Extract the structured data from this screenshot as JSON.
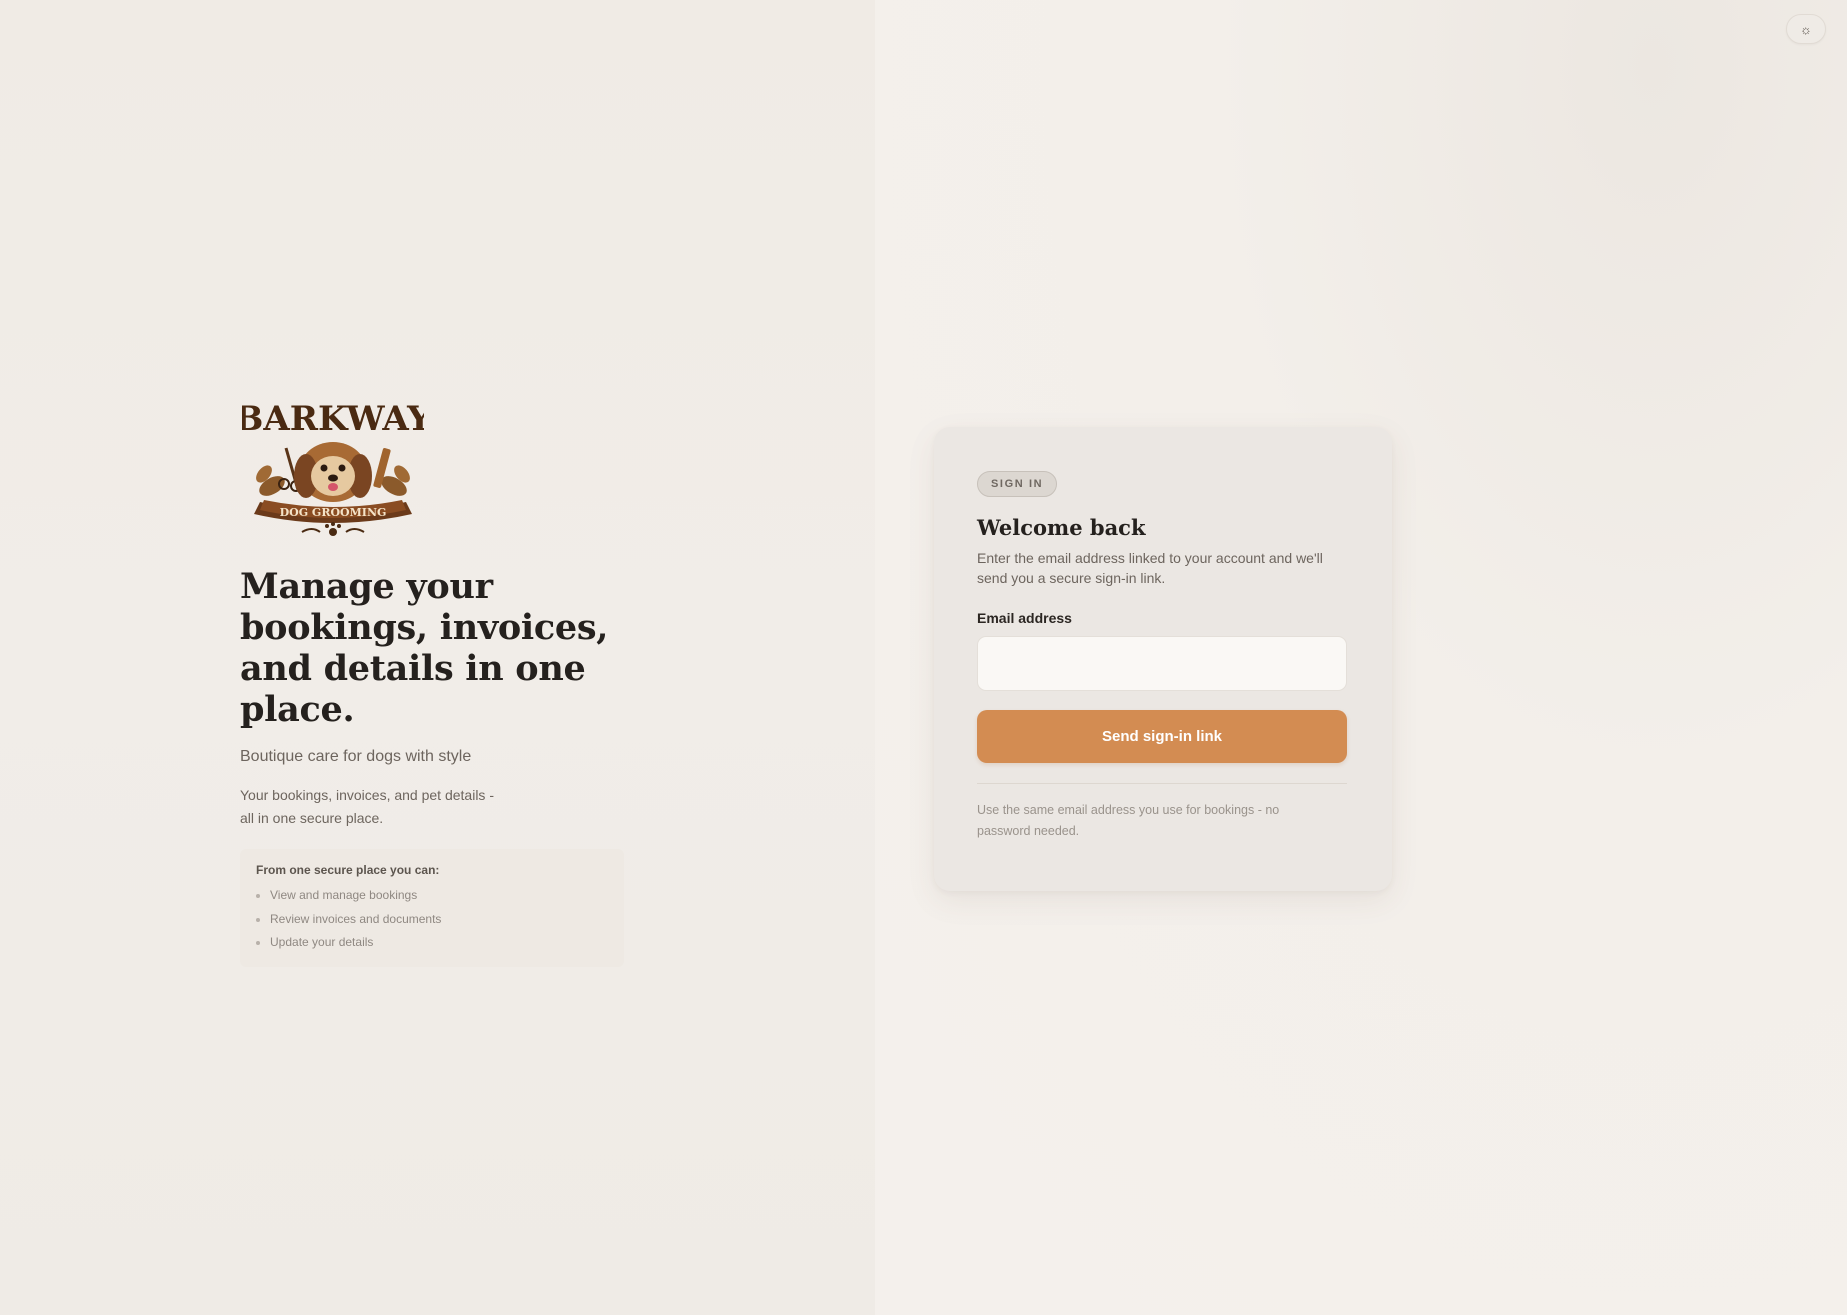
{
  "theme_toggle": {
    "icon": "sun-icon",
    "glyph": "☼"
  },
  "brand": {
    "logo": {
      "icon": "barkway-logo",
      "wordmark": "BARKWAY",
      "banner": "DOG GROOMING"
    },
    "headline": "Manage your bookings, invoices, and details in one place.",
    "tagline": "Boutique care for dogs with style",
    "description": "Your bookings, invoices, and pet details - all in one secure place.",
    "features": {
      "title": "From one secure place you can:",
      "items": [
        "View and manage bookings",
        "Review invoices and documents",
        "Update your details"
      ]
    }
  },
  "signin": {
    "badge": "SIGN IN",
    "title": "Welcome back",
    "subtitle": "Enter the email address linked to your account and we'll send you a secure sign-in link.",
    "email_label": "Email address",
    "email_value": "",
    "email_placeholder": "",
    "submit_label": "Send sign-in link",
    "note": "Use the same email address you use for bookings - no password needed."
  },
  "colors": {
    "accent": "#d38c52",
    "background": "#f2eee9",
    "card": "#ebe7e3",
    "text": "#25211e"
  }
}
